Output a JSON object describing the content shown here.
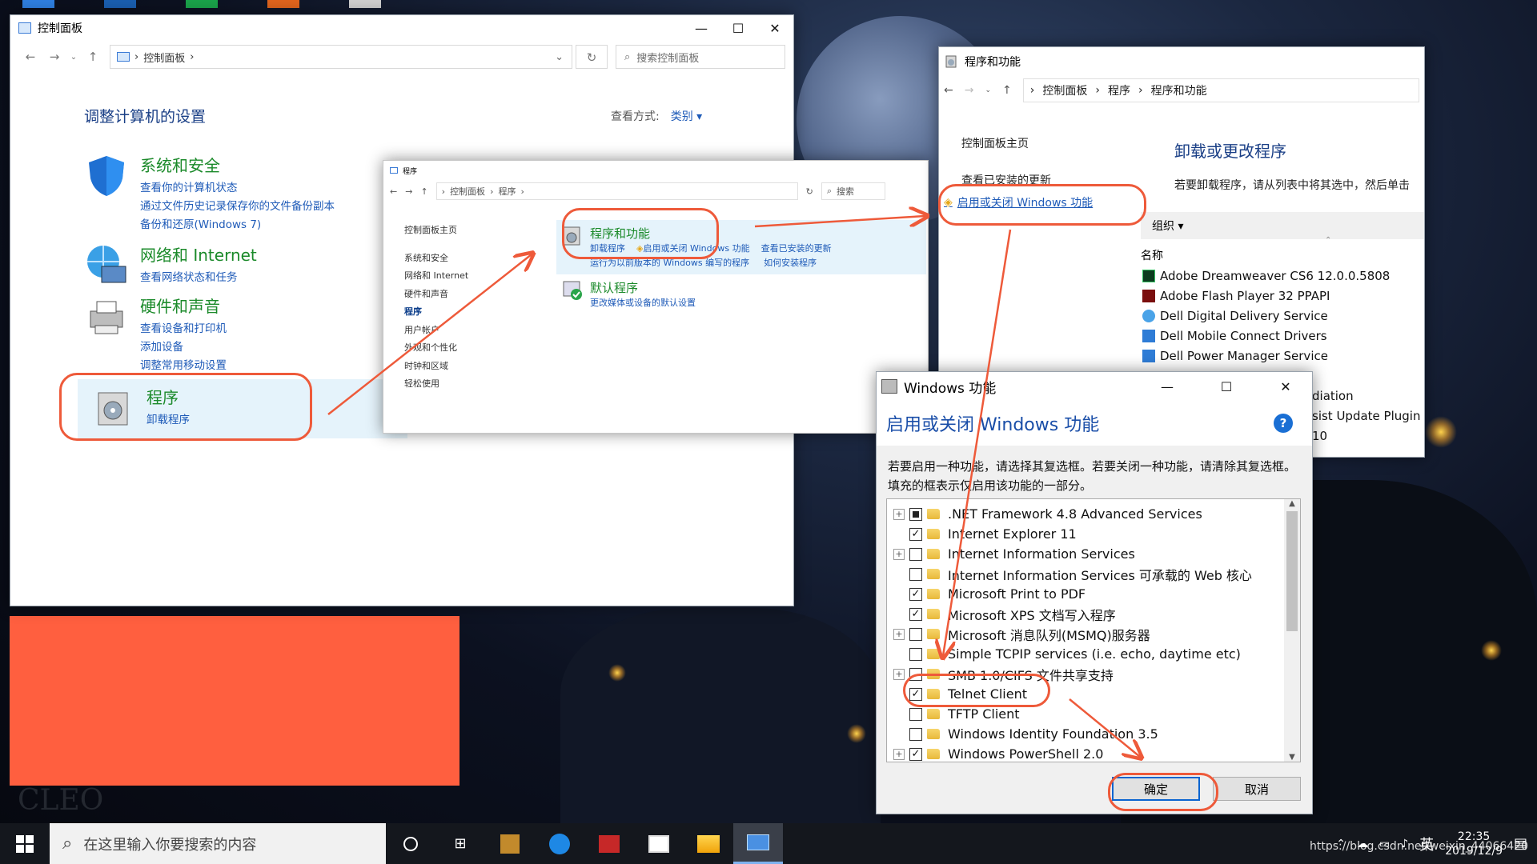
{
  "cp": {
    "title": "控制面板",
    "breadcrumb": "控制面板",
    "search_placeholder": "搜索控制面板",
    "heading": "调整计算机的设置",
    "view_label": "查看方式:",
    "view_value": "类别",
    "categories": [
      {
        "title": "系统和安全",
        "links": [
          "查看你的计算机状态",
          "通过文件历史记录保存你的文件备份副本",
          "备份和还原(Windows 7)"
        ]
      },
      {
        "title": "网络和 Internet",
        "links": [
          "查看网络状态和任务"
        ]
      },
      {
        "title": "硬件和声音",
        "links": [
          "查看设备和打印机",
          "添加设备",
          "调整常用移动设置"
        ]
      },
      {
        "title": "程序",
        "links": [
          "卸载程序"
        ]
      }
    ]
  },
  "prog": {
    "title": "程序",
    "breadcrumb": [
      "控制面板",
      "程序"
    ],
    "search_placeholder": "搜索",
    "sidebar": [
      "控制面板主页",
      "系统和安全",
      "网络和 Internet",
      "硬件和声音",
      "程序",
      "用户帐户",
      "外观和个性化",
      "时钟和区域",
      "轻松使用"
    ],
    "pf_title": "程序和功能",
    "pf_links": [
      "卸载程序",
      "启用或关闭 Windows 功能",
      "查看已安装的更新",
      "运行为以前版本的 Windows 编写的程序",
      "如何安装程序"
    ],
    "dp_title": "默认程序",
    "dp_link": "更改媒体或设备的默认设置"
  },
  "pnf": {
    "title": "程序和功能",
    "breadcrumb": [
      "控制面板",
      "程序",
      "程序和功能"
    ],
    "sidebar": [
      "控制面板主页",
      "查看已安装的更新",
      "启用或关闭 Windows 功能"
    ],
    "heading": "卸载或更改程序",
    "desc": "若要卸载程序，请从列表中将其选中，然后单击",
    "organize": "组织",
    "col_name": "名称",
    "programs": [
      "Adobe Dreamweaver CS6 12.0.0.5808",
      "Adobe Flash Player 32 PPAPI",
      "Dell Digital Delivery Service",
      "Dell Mobile Connect Drivers",
      "Dell Power Manager Service"
    ],
    "partial": [
      "diation",
      "sist Update Plugin",
      "10"
    ]
  },
  "wf": {
    "title": "Windows 功能",
    "heading": "启用或关闭 Windows 功能",
    "desc": "若要启用一种功能，请选择其复选框。若要关闭一种功能，请清除其复选框。填充的框表示仅启用该功能的一部分。",
    "features": [
      {
        "label": ".NET Framework 4.8 Advanced Services",
        "expand": true,
        "state": "partial"
      },
      {
        "label": "Internet Explorer 11",
        "expand": false,
        "state": "checked"
      },
      {
        "label": "Internet Information Services",
        "expand": true,
        "state": "unchecked"
      },
      {
        "label": "Internet Information Services 可承载的 Web 核心",
        "expand": false,
        "state": "unchecked"
      },
      {
        "label": "Microsoft Print to PDF",
        "expand": false,
        "state": "checked"
      },
      {
        "label": "Microsoft XPS 文档写入程序",
        "expand": false,
        "state": "checked"
      },
      {
        "label": "Microsoft 消息队列(MSMQ)服务器",
        "expand": true,
        "state": "unchecked"
      },
      {
        "label": "Simple TCPIP services (i.e. echo, daytime etc)",
        "expand": false,
        "state": "unchecked"
      },
      {
        "label": "SMB 1.0/CIFS 文件共享支持",
        "expand": true,
        "state": "unchecked"
      },
      {
        "label": "Telnet Client",
        "expand": false,
        "state": "checked"
      },
      {
        "label": "TFTP Client",
        "expand": false,
        "state": "unchecked"
      },
      {
        "label": "Windows Identity Foundation 3.5",
        "expand": false,
        "state": "unchecked"
      },
      {
        "label": "Windows PowerShell 2.0",
        "expand": true,
        "state": "checked"
      }
    ],
    "ok": "确定",
    "cancel": "取消"
  },
  "taskbar": {
    "search_placeholder": "在这里输入你要搜索的内容",
    "ime": "英",
    "time": "22:35",
    "date": "2019/12/9",
    "watermark": "https://blog.csdn.net/weixin_44066420"
  },
  "colors": {
    "annotation": "#ee5a3a",
    "link": "#1f5bb8",
    "title_green": "#1b8a2a"
  }
}
